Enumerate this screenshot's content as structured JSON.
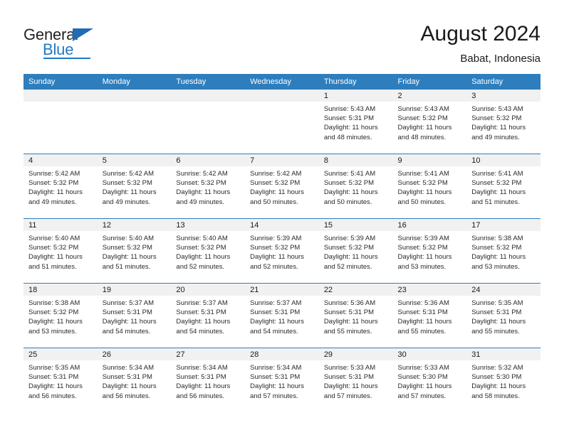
{
  "brand": {
    "name_part1": "General",
    "name_part2": "Blue"
  },
  "header": {
    "title": "August 2024",
    "location": "Babat, Indonesia"
  },
  "weekday_headers": [
    "Sunday",
    "Monday",
    "Tuesday",
    "Wednesday",
    "Thursday",
    "Friday",
    "Saturday"
  ],
  "colors": {
    "header_blue": "#2e7ebd",
    "date_band_gray": "#f1f1f1",
    "logo_blue": "#1f7ac4",
    "text": "#1a1a1a"
  },
  "weeks": [
    [
      {
        "day": "",
        "sunrise": "",
        "sunset": "",
        "daylight_line1": "",
        "daylight_line2": ""
      },
      {
        "day": "",
        "sunrise": "",
        "sunset": "",
        "daylight_line1": "",
        "daylight_line2": ""
      },
      {
        "day": "",
        "sunrise": "",
        "sunset": "",
        "daylight_line1": "",
        "daylight_line2": ""
      },
      {
        "day": "",
        "sunrise": "",
        "sunset": "",
        "daylight_line1": "",
        "daylight_line2": ""
      },
      {
        "day": "1",
        "sunrise": "Sunrise: 5:43 AM",
        "sunset": "Sunset: 5:31 PM",
        "daylight_line1": "Daylight: 11 hours",
        "daylight_line2": "and 48 minutes."
      },
      {
        "day": "2",
        "sunrise": "Sunrise: 5:43 AM",
        "sunset": "Sunset: 5:32 PM",
        "daylight_line1": "Daylight: 11 hours",
        "daylight_line2": "and 48 minutes."
      },
      {
        "day": "3",
        "sunrise": "Sunrise: 5:43 AM",
        "sunset": "Sunset: 5:32 PM",
        "daylight_line1": "Daylight: 11 hours",
        "daylight_line2": "and 49 minutes."
      }
    ],
    [
      {
        "day": "4",
        "sunrise": "Sunrise: 5:42 AM",
        "sunset": "Sunset: 5:32 PM",
        "daylight_line1": "Daylight: 11 hours",
        "daylight_line2": "and 49 minutes."
      },
      {
        "day": "5",
        "sunrise": "Sunrise: 5:42 AM",
        "sunset": "Sunset: 5:32 PM",
        "daylight_line1": "Daylight: 11 hours",
        "daylight_line2": "and 49 minutes."
      },
      {
        "day": "6",
        "sunrise": "Sunrise: 5:42 AM",
        "sunset": "Sunset: 5:32 PM",
        "daylight_line1": "Daylight: 11 hours",
        "daylight_line2": "and 49 minutes."
      },
      {
        "day": "7",
        "sunrise": "Sunrise: 5:42 AM",
        "sunset": "Sunset: 5:32 PM",
        "daylight_line1": "Daylight: 11 hours",
        "daylight_line2": "and 50 minutes."
      },
      {
        "day": "8",
        "sunrise": "Sunrise: 5:41 AM",
        "sunset": "Sunset: 5:32 PM",
        "daylight_line1": "Daylight: 11 hours",
        "daylight_line2": "and 50 minutes."
      },
      {
        "day": "9",
        "sunrise": "Sunrise: 5:41 AM",
        "sunset": "Sunset: 5:32 PM",
        "daylight_line1": "Daylight: 11 hours",
        "daylight_line2": "and 50 minutes."
      },
      {
        "day": "10",
        "sunrise": "Sunrise: 5:41 AM",
        "sunset": "Sunset: 5:32 PM",
        "daylight_line1": "Daylight: 11 hours",
        "daylight_line2": "and 51 minutes."
      }
    ],
    [
      {
        "day": "11",
        "sunrise": "Sunrise: 5:40 AM",
        "sunset": "Sunset: 5:32 PM",
        "daylight_line1": "Daylight: 11 hours",
        "daylight_line2": "and 51 minutes."
      },
      {
        "day": "12",
        "sunrise": "Sunrise: 5:40 AM",
        "sunset": "Sunset: 5:32 PM",
        "daylight_line1": "Daylight: 11 hours",
        "daylight_line2": "and 51 minutes."
      },
      {
        "day": "13",
        "sunrise": "Sunrise: 5:40 AM",
        "sunset": "Sunset: 5:32 PM",
        "daylight_line1": "Daylight: 11 hours",
        "daylight_line2": "and 52 minutes."
      },
      {
        "day": "14",
        "sunrise": "Sunrise: 5:39 AM",
        "sunset": "Sunset: 5:32 PM",
        "daylight_line1": "Daylight: 11 hours",
        "daylight_line2": "and 52 minutes."
      },
      {
        "day": "15",
        "sunrise": "Sunrise: 5:39 AM",
        "sunset": "Sunset: 5:32 PM",
        "daylight_line1": "Daylight: 11 hours",
        "daylight_line2": "and 52 minutes."
      },
      {
        "day": "16",
        "sunrise": "Sunrise: 5:39 AM",
        "sunset": "Sunset: 5:32 PM",
        "daylight_line1": "Daylight: 11 hours",
        "daylight_line2": "and 53 minutes."
      },
      {
        "day": "17",
        "sunrise": "Sunrise: 5:38 AM",
        "sunset": "Sunset: 5:32 PM",
        "daylight_line1": "Daylight: 11 hours",
        "daylight_line2": "and 53 minutes."
      }
    ],
    [
      {
        "day": "18",
        "sunrise": "Sunrise: 5:38 AM",
        "sunset": "Sunset: 5:32 PM",
        "daylight_line1": "Daylight: 11 hours",
        "daylight_line2": "and 53 minutes."
      },
      {
        "day": "19",
        "sunrise": "Sunrise: 5:37 AM",
        "sunset": "Sunset: 5:31 PM",
        "daylight_line1": "Daylight: 11 hours",
        "daylight_line2": "and 54 minutes."
      },
      {
        "day": "20",
        "sunrise": "Sunrise: 5:37 AM",
        "sunset": "Sunset: 5:31 PM",
        "daylight_line1": "Daylight: 11 hours",
        "daylight_line2": "and 54 minutes."
      },
      {
        "day": "21",
        "sunrise": "Sunrise: 5:37 AM",
        "sunset": "Sunset: 5:31 PM",
        "daylight_line1": "Daylight: 11 hours",
        "daylight_line2": "and 54 minutes."
      },
      {
        "day": "22",
        "sunrise": "Sunrise: 5:36 AM",
        "sunset": "Sunset: 5:31 PM",
        "daylight_line1": "Daylight: 11 hours",
        "daylight_line2": "and 55 minutes."
      },
      {
        "day": "23",
        "sunrise": "Sunrise: 5:36 AM",
        "sunset": "Sunset: 5:31 PM",
        "daylight_line1": "Daylight: 11 hours",
        "daylight_line2": "and 55 minutes."
      },
      {
        "day": "24",
        "sunrise": "Sunrise: 5:35 AM",
        "sunset": "Sunset: 5:31 PM",
        "daylight_line1": "Daylight: 11 hours",
        "daylight_line2": "and 55 minutes."
      }
    ],
    [
      {
        "day": "25",
        "sunrise": "Sunrise: 5:35 AM",
        "sunset": "Sunset: 5:31 PM",
        "daylight_line1": "Daylight: 11 hours",
        "daylight_line2": "and 56 minutes."
      },
      {
        "day": "26",
        "sunrise": "Sunrise: 5:34 AM",
        "sunset": "Sunset: 5:31 PM",
        "daylight_line1": "Daylight: 11 hours",
        "daylight_line2": "and 56 minutes."
      },
      {
        "day": "27",
        "sunrise": "Sunrise: 5:34 AM",
        "sunset": "Sunset: 5:31 PM",
        "daylight_line1": "Daylight: 11 hours",
        "daylight_line2": "and 56 minutes."
      },
      {
        "day": "28",
        "sunrise": "Sunrise: 5:34 AM",
        "sunset": "Sunset: 5:31 PM",
        "daylight_line1": "Daylight: 11 hours",
        "daylight_line2": "and 57 minutes."
      },
      {
        "day": "29",
        "sunrise": "Sunrise: 5:33 AM",
        "sunset": "Sunset: 5:31 PM",
        "daylight_line1": "Daylight: 11 hours",
        "daylight_line2": "and 57 minutes."
      },
      {
        "day": "30",
        "sunrise": "Sunrise: 5:33 AM",
        "sunset": "Sunset: 5:30 PM",
        "daylight_line1": "Daylight: 11 hours",
        "daylight_line2": "and 57 minutes."
      },
      {
        "day": "31",
        "sunrise": "Sunrise: 5:32 AM",
        "sunset": "Sunset: 5:30 PM",
        "daylight_line1": "Daylight: 11 hours",
        "daylight_line2": "and 58 minutes."
      }
    ]
  ]
}
